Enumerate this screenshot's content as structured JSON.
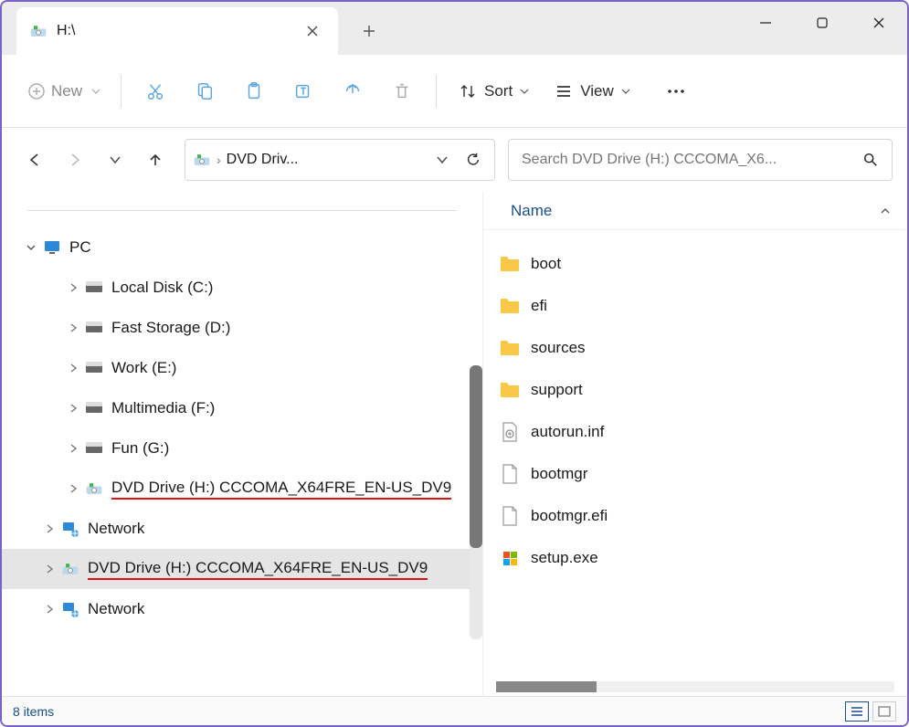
{
  "tab": {
    "title": "H:\\"
  },
  "toolbar": {
    "new": "New",
    "sort": "Sort",
    "view": "View"
  },
  "address": {
    "crumb": "DVD Driv..."
  },
  "search": {
    "placeholder": "Search DVD Drive (H:) CCCOMA_X6..."
  },
  "tree": {
    "pc": "PC",
    "nodes": [
      {
        "label": "Local Disk (C:)"
      },
      {
        "label": "Fast Storage (D:)"
      },
      {
        "label": "Work (E:)"
      },
      {
        "label": "Multimedia (F:)"
      },
      {
        "label": "Fun (G:)"
      },
      {
        "label": "DVD Drive (H:) CCCOMA_X64FRE_EN-US_DV9",
        "underline": true
      },
      {
        "label": "Network",
        "net": true,
        "indent": 1
      },
      {
        "label": "DVD Drive (H:) CCCOMA_X64FRE_EN-US_DV9",
        "underline": true,
        "indent": 1,
        "selected": true
      },
      {
        "label": "Network",
        "net": true,
        "indent": 1
      }
    ]
  },
  "list": {
    "column": "Name",
    "items": [
      {
        "name": "boot",
        "type": "folder"
      },
      {
        "name": "efi",
        "type": "folder"
      },
      {
        "name": "sources",
        "type": "folder"
      },
      {
        "name": "support",
        "type": "folder"
      },
      {
        "name": "autorun.inf",
        "type": "inf"
      },
      {
        "name": "bootmgr",
        "type": "file"
      },
      {
        "name": "bootmgr.efi",
        "type": "file"
      },
      {
        "name": "setup.exe",
        "type": "exe"
      }
    ]
  },
  "status": {
    "text": "8 items"
  }
}
